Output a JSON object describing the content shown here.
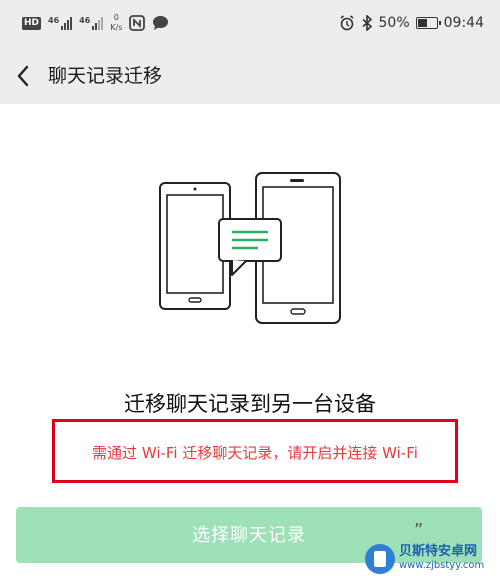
{
  "status_bar": {
    "hd": "HD",
    "net1": "46",
    "net2": "46",
    "speed_value": "0",
    "speed_unit": "K/s",
    "battery": "50%",
    "time": "09:44"
  },
  "nav": {
    "title": "聊天记录迁移"
  },
  "content": {
    "headline": "迁移聊天记录到另一台设备",
    "warning": "需通过 Wi-Fi 迁移聊天记录，请开启并连接 Wi-Fi"
  },
  "button": {
    "label": "选择聊天记录"
  },
  "watermark": {
    "name": "贝斯特安卓网",
    "url": "www.zjbstyy.com"
  },
  "colors": {
    "accent": "#2aae67",
    "warning_border": "#e0001b",
    "warning_text": "#e83a3a",
    "button_disabled": "#9ee0b8"
  }
}
